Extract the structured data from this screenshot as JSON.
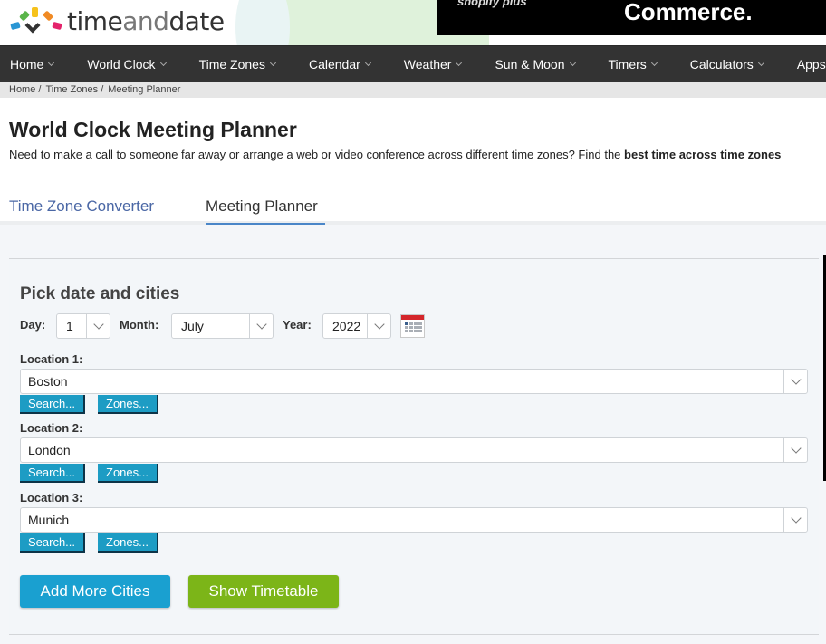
{
  "header": {
    "logo": {
      "part1": "time",
      "part2": "and",
      "part3": "date"
    },
    "ad": {
      "brand": "shopify plus",
      "text": "Commerce."
    }
  },
  "nav": {
    "items": [
      {
        "label": "Home"
      },
      {
        "label": "World Clock"
      },
      {
        "label": "Time Zones"
      },
      {
        "label": "Calendar"
      },
      {
        "label": "Weather"
      },
      {
        "label": "Sun & Moon"
      },
      {
        "label": "Timers"
      },
      {
        "label": "Calculators"
      },
      {
        "label": "Apps &"
      }
    ]
  },
  "breadcrumb": [
    "Home /",
    "Time Zones /",
    "Meeting Planner"
  ],
  "page": {
    "title": "World Clock Meeting Planner",
    "intro_text": "Need to make a call to someone far away or arrange a web or video conference across different time zones? Find the ",
    "intro_bold": "best time across time zones"
  },
  "tabs": [
    {
      "label": "Time Zone Converter",
      "active": false
    },
    {
      "label": "Meeting Planner",
      "active": true
    }
  ],
  "form": {
    "title": "Pick date and cities",
    "day_label": "Day:",
    "day_value": "1",
    "month_label": "Month:",
    "month_value": "July",
    "year_label": "Year:",
    "year_value": "2022",
    "calendar_icon": "calendar-icon",
    "locations": [
      {
        "label": "Location 1:",
        "value": "Boston"
      },
      {
        "label": "Location 2:",
        "value": "London"
      },
      {
        "label": "Location 3:",
        "value": "Munich"
      }
    ],
    "search_label": "Search...",
    "zones_label": "Zones...",
    "add_more_label": "Add More Cities",
    "show_timetable_label": "Show Timetable"
  },
  "colors": {
    "nav_bg": "#333333",
    "tab_active": "#4a86c8",
    "link": "#4a67a5",
    "small_button": "#1d9cc4",
    "add_button": "#1aa0d0",
    "show_button": "#7cb518"
  }
}
